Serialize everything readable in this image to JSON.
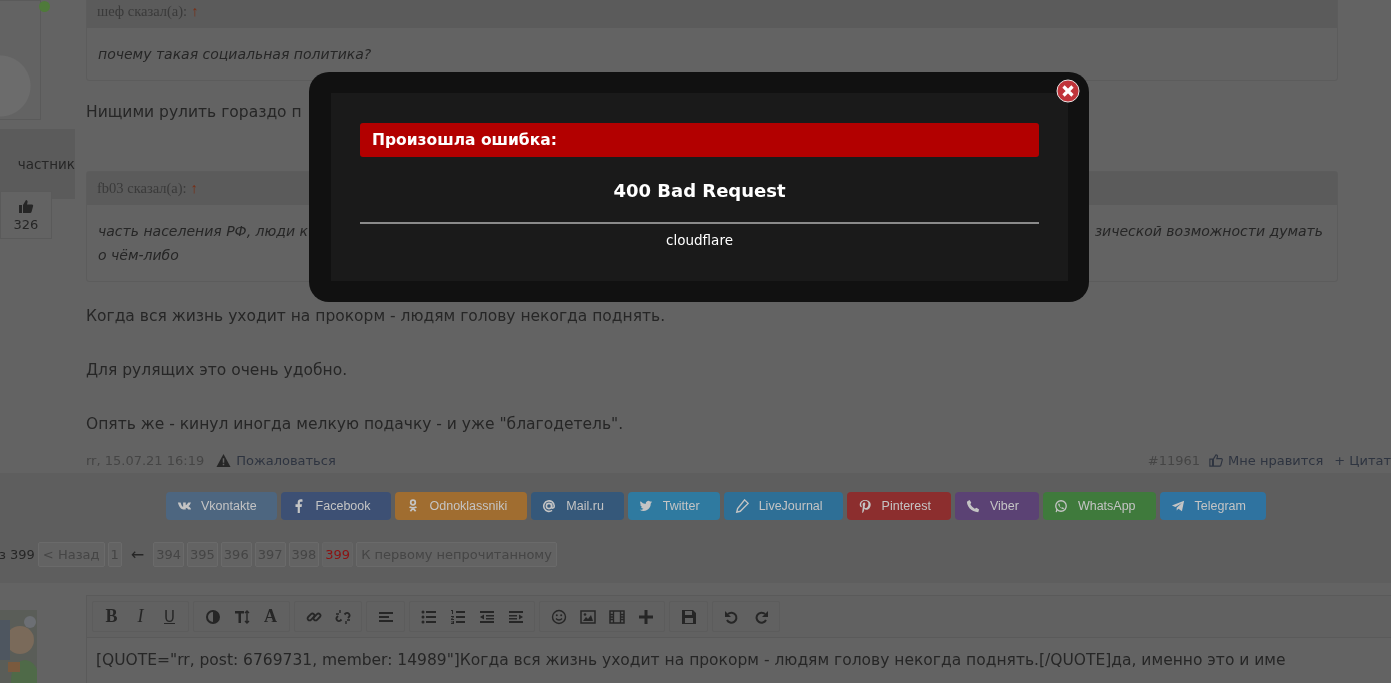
{
  "sidebar": {
    "role": "частник",
    "likes": "326"
  },
  "content": [
    {
      "kind": "quote",
      "author": "шеф сказал(а):",
      "arrow": "↑",
      "lines": [
        [
          "почему такая социальная политика?"
        ]
      ]
    },
    {
      "kind": "paragraph",
      "text": "Нищими рулить гораздо п"
    },
    {
      "kind": "quote",
      "author": "fb03 сказал(а):",
      "arrow": "↑",
      "lines": [
        [
          "часть населения РФ, люди к",
          "зической возможности думать"
        ],
        [
          "о чём-либо"
        ]
      ]
    },
    {
      "kind": "paragraph",
      "text": "Когда вся жизнь уходит на прокорм - людям голову некогда поднять."
    },
    {
      "kind": "paragraph",
      "text": "Для рулящих это очень удобно."
    },
    {
      "kind": "paragraph",
      "text": "Опять же - кинул иногда мелкую подачку - и уже \"благодетель\"."
    }
  ],
  "post_footer": {
    "author_date": "rr, 15.07.21 16:19",
    "report": "Пожаловаться",
    "post_number": "#11961",
    "like": "Мне нравится",
    "quote": "+ Цитат"
  },
  "share_buttons": [
    {
      "label": "Vkontakte",
      "color": "#4d6680"
    },
    {
      "label": "Facebook",
      "color": "#3d5074"
    },
    {
      "label": "Odnoklassniki",
      "color": "#a06d30"
    },
    {
      "label": "Mail.ru",
      "color": "#35587a"
    },
    {
      "label": "Twitter",
      "color": "#2f7aa0"
    },
    {
      "label": "LiveJournal",
      "color": "#2e6f96"
    },
    {
      "label": "Pinterest",
      "color": "#8c2e2e"
    },
    {
      "label": "Viber",
      "color": "#5b4274"
    },
    {
      "label": "WhatsApp",
      "color": "#3f7a3c"
    },
    {
      "label": "Telegram",
      "color": "#2f73a0"
    }
  ],
  "pagination": {
    "label": "з 399",
    "prev": "< Назад",
    "first": {
      "label": "1",
      "selected": false
    },
    "gap": "←",
    "pages": [
      {
        "label": "394",
        "selected": false
      },
      {
        "label": "395",
        "selected": false
      },
      {
        "label": "396",
        "selected": false
      },
      {
        "label": "397",
        "selected": false
      },
      {
        "label": "398",
        "selected": false
      },
      {
        "label": "399",
        "selected": true
      }
    ],
    "first_unread": "К первому непрочитанному"
  },
  "editor": {
    "toolbar": [
      [
        {
          "kind": "text",
          "label": "B"
        },
        {
          "kind": "text",
          "label": "I"
        },
        {
          "kind": "text",
          "label": "U"
        }
      ],
      [
        {
          "kind": "icon"
        },
        {
          "kind": "icon"
        },
        {
          "kind": "text",
          "label": "A"
        }
      ],
      [
        {
          "kind": "icon"
        },
        {
          "kind": "icon"
        }
      ],
      [
        {
          "kind": "icon"
        }
      ],
      [
        {
          "kind": "icon"
        },
        {
          "kind": "icon"
        },
        {
          "kind": "icon"
        },
        {
          "kind": "icon"
        }
      ],
      [
        {
          "kind": "icon"
        },
        {
          "kind": "icon"
        },
        {
          "kind": "icon"
        },
        {
          "kind": "icon"
        }
      ],
      [
        {
          "kind": "icon"
        }
      ],
      [
        {
          "kind": "icon"
        },
        {
          "kind": "icon"
        }
      ]
    ],
    "value": "[QUOTE=\"rr, post: 6769731, member: 14989\"]Когда вся жизнь уходит на прокорм - людям голову некогда поднять.[/QUOTE]да, именно это и име"
  },
  "modal": {
    "title": "Произошла ошибка:",
    "message": "400 Bad Request",
    "source": "cloudflare"
  }
}
